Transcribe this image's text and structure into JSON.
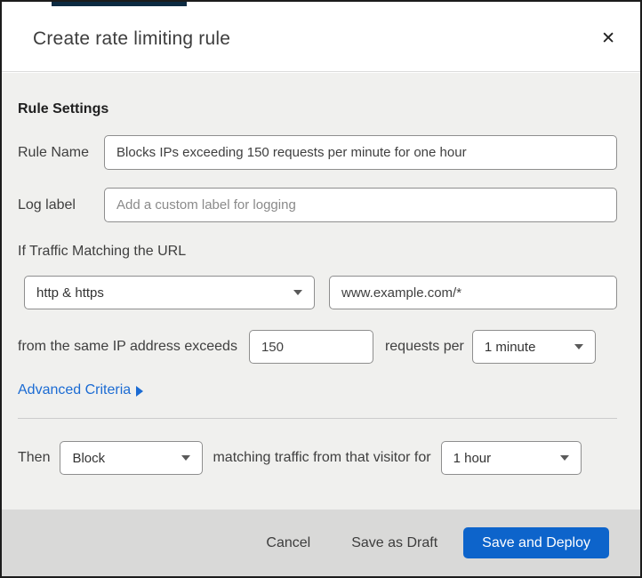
{
  "backdrop": {
    "top_bar_color": "#0d2b42"
  },
  "modal": {
    "title": "Create rate limiting rule",
    "close_icon": "✕"
  },
  "form": {
    "section_heading": "Rule Settings",
    "rule_name": {
      "label": "Rule Name",
      "value": "Blocks IPs exceeding 150 requests per minute for one hour"
    },
    "log_label": {
      "label": "Log label",
      "placeholder": "Add a custom label for logging"
    },
    "traffic_match": {
      "heading": "If Traffic Matching the URL",
      "scheme_selected": "http & https",
      "url_value": "www.example.com/*"
    },
    "threshold": {
      "prefix": "from the same IP address exceeds",
      "requests_value": "150",
      "middle": "requests per",
      "period_selected": "1 minute"
    },
    "advanced_criteria": {
      "label": "Advanced Criteria"
    },
    "action": {
      "prefix": "Then",
      "action_selected": "Block",
      "middle": "matching traffic from that visitor for",
      "duration_selected": "1 hour"
    }
  },
  "footer": {
    "cancel_label": "Cancel",
    "save_draft_label": "Save as Draft",
    "save_deploy_label": "Save and Deploy"
  },
  "colors": {
    "link_blue": "#1b6bd3",
    "primary_button_blue": "#0d64cb",
    "body_background": "#f0f0ee",
    "footer_background": "#d9d9d8"
  }
}
